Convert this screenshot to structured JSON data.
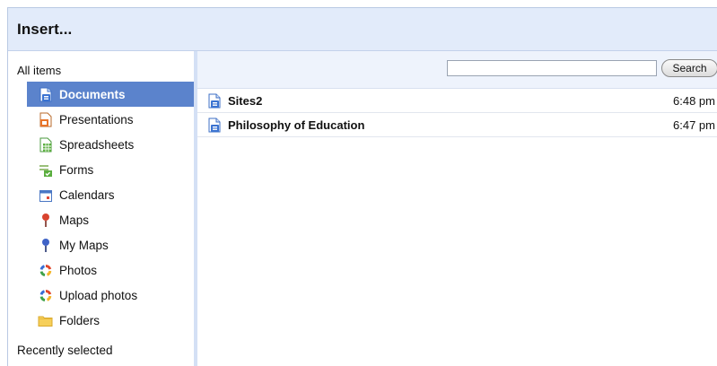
{
  "dialog": {
    "title": "Insert..."
  },
  "sidebar": {
    "all_items_label": "All items",
    "items": [
      {
        "label": "Documents",
        "icon": "document-icon"
      },
      {
        "label": "Presentations",
        "icon": "presentation-icon"
      },
      {
        "label": "Spreadsheets",
        "icon": "spreadsheet-icon"
      },
      {
        "label": "Forms",
        "icon": "form-icon"
      },
      {
        "label": "Calendars",
        "icon": "calendar-icon"
      },
      {
        "label": "Maps",
        "icon": "map-pin-icon"
      },
      {
        "label": "My Maps",
        "icon": "my-map-pin-icon"
      },
      {
        "label": "Photos",
        "icon": "photos-icon"
      },
      {
        "label": "Upload photos",
        "icon": "upload-photos-icon"
      },
      {
        "label": "Folders",
        "icon": "folder-icon"
      }
    ],
    "selected": "Documents",
    "recently_selected_label": "Recently selected"
  },
  "search": {
    "value": "",
    "placeholder": "",
    "button_label": "Search"
  },
  "documents": [
    {
      "title": "Sites2",
      "time": "6:48 pm",
      "icon": "document-icon"
    },
    {
      "title": "Philosophy of Education",
      "time": "6:47 pm",
      "icon": "document-icon"
    }
  ],
  "colors": {
    "title_bar": "#e2ebfa",
    "selected_item": "#5b83cc",
    "sidebar_divider": "#d4e0f5"
  }
}
